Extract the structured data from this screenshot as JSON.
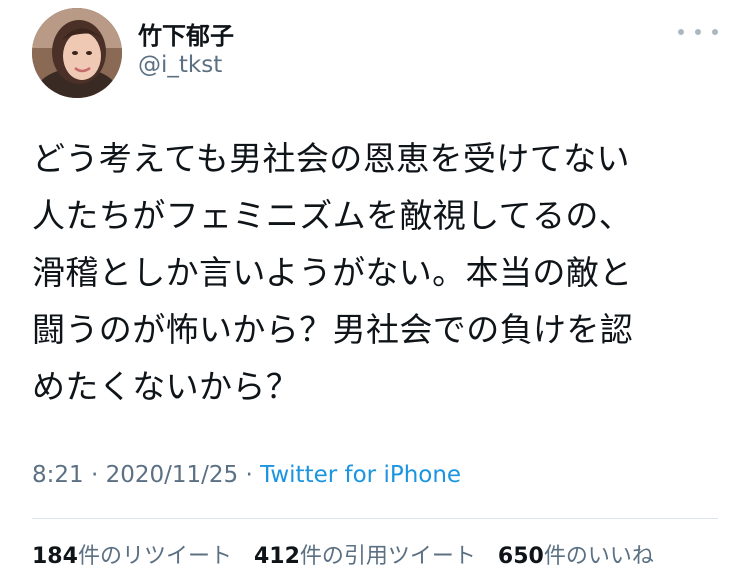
{
  "author": {
    "display_name": "竹下郁子",
    "handle": "@i_tkst",
    "avatar_icon": "profile-photo"
  },
  "more_icon": "more-horizontal-icon",
  "tweet": {
    "lines": [
      "どう考えても男社会の恩恵を受けてない",
      "人たちがフェミニズムを敵視してるの、",
      "滑稽としか言いようがない。本当の敵と",
      "闘うのが怖いから？男社会での負けを認",
      "めたくないから？"
    ]
  },
  "meta": {
    "time": "8:21",
    "sep1": " · ",
    "date": "2020/11/25",
    "sep2": " · ",
    "source": "Twitter for iPhone"
  },
  "stats": {
    "retweets": {
      "count": "184",
      "label": "件のリツイート"
    },
    "quotes": {
      "count": "412",
      "label": "件の引用ツイート"
    },
    "likes": {
      "count": "650",
      "label": "件のいいね"
    }
  },
  "colors": {
    "text": "#0f1419",
    "secondary": "#5b7083",
    "link": "#1b95e0",
    "divider": "#dde3e8"
  }
}
